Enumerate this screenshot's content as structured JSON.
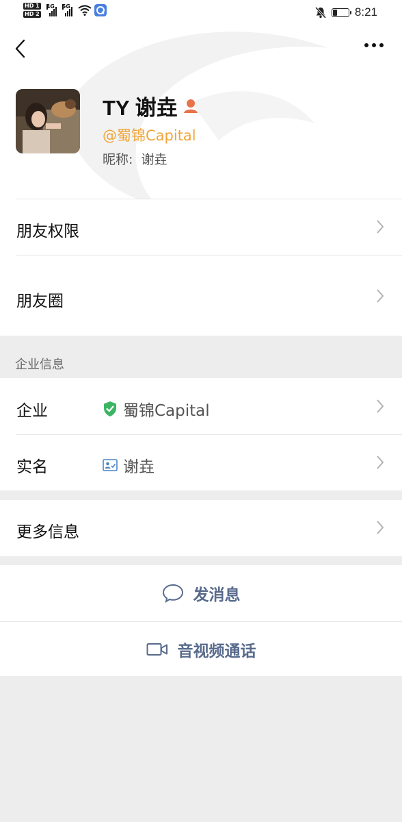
{
  "status_bar": {
    "time": "8:21",
    "net1": "4G",
    "net2": "5G",
    "hd": [
      "HD 1",
      "HD 2"
    ],
    "battery_level": 0.3
  },
  "profile": {
    "name": "TY 谢垚",
    "handle": "@蜀锦Capital",
    "nickname_label": "昵称:",
    "nickname": "谢垚"
  },
  "menu": {
    "friend_permissions": "朋友权限",
    "moments": "朋友圈"
  },
  "enterprise": {
    "section_title": "企业信息",
    "company_label": "企业",
    "company_value": "蜀锦Capital",
    "realname_label": "实名",
    "realname_value": "谢垚"
  },
  "more_info": "更多信息",
  "actions": {
    "message": "发消息",
    "call": "音视频通话"
  },
  "colors": {
    "accent_link": "#586b8c",
    "handle_orange": "#f0a53a",
    "verified_green": "#3cb464"
  }
}
